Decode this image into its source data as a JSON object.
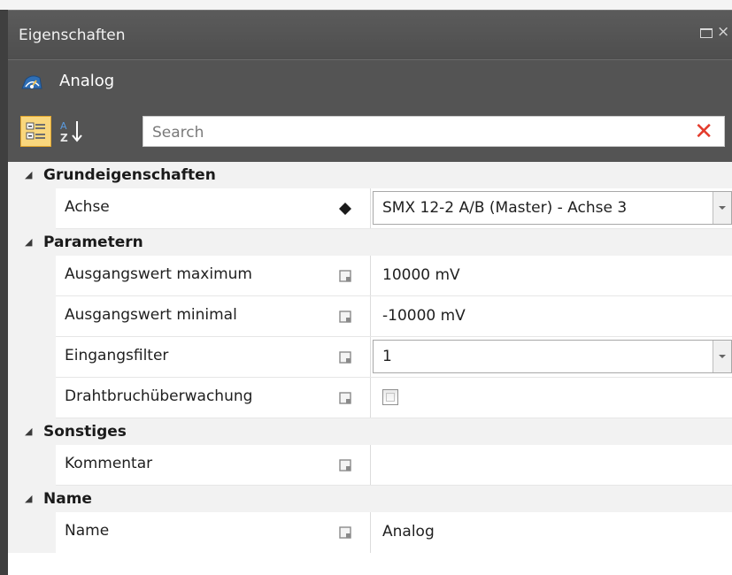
{
  "panel": {
    "title": "Eigenschaften",
    "object_name": "Analog"
  },
  "icons": {
    "object": "meter-icon",
    "categorized": "categorized-view-icon",
    "alphabetical": "sort-az-icon",
    "clear": "clear-x-icon",
    "restore": "restore-window-icon",
    "close": "close-icon",
    "expand": "expand-triangle-icon",
    "binding": "diamond-icon",
    "value_marker": "edit-marker-icon"
  },
  "search": {
    "placeholder": "Search",
    "value": ""
  },
  "categories": [
    {
      "label": "Grundeigenschaften",
      "properties": [
        {
          "name": "Achse",
          "value": "SMX 12-2 A/B (Master) - Achse 3",
          "editor": "combo",
          "marker": "diamond"
        }
      ]
    },
    {
      "label": "Parametern",
      "properties": [
        {
          "name": "Ausgangswert maximum",
          "value": "10000 mV",
          "editor": "text",
          "marker": "square"
        },
        {
          "name": "Ausgangswert minimal",
          "value": "-10000 mV",
          "editor": "text",
          "marker": "square"
        },
        {
          "name": "Eingangsfilter",
          "value": "1",
          "editor": "combo",
          "marker": "square"
        },
        {
          "name": "Drahtbruchüberwachung",
          "value": false,
          "editor": "checkbox",
          "marker": "square"
        }
      ]
    },
    {
      "label": "Sonstiges",
      "properties": [
        {
          "name": "Kommentar",
          "value": "",
          "editor": "text",
          "marker": "square"
        }
      ]
    },
    {
      "label": "Name",
      "properties": [
        {
          "name": "Name",
          "value": "Analog",
          "editor": "text",
          "marker": "square"
        }
      ]
    }
  ],
  "colors": {
    "titlebar": "#545454",
    "toolbar_active": "#f9d77e",
    "clear_x": "#e33b2c",
    "category_bg": "#f2f2f2"
  }
}
